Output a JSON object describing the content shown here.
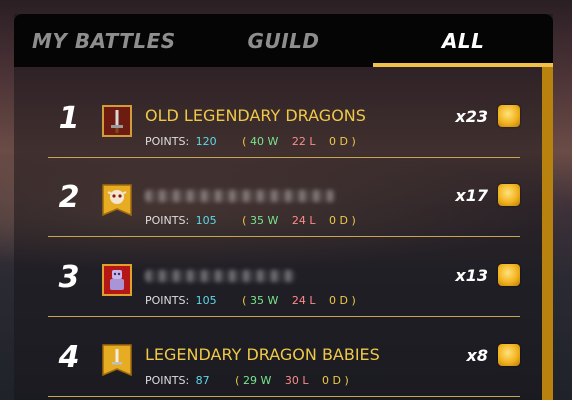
{
  "tabs": [
    {
      "label": "MY BATTLES",
      "active": false
    },
    {
      "label": "GUILD",
      "active": false
    },
    {
      "label": "ALL",
      "active": true
    }
  ],
  "colors": {
    "accent": "#f0c048",
    "scrollbar": "#b9820f"
  },
  "rows": [
    {
      "rank": "1",
      "name": "OLD LEGENDARY DRAGONS",
      "name_obscured": false,
      "banner": "red-sword-banner-icon",
      "points_label": "POINTS:",
      "points": "120",
      "wins": "40 W",
      "losses": "22 L",
      "draws": "0 D",
      "multiplier": "x23",
      "reward_icon": "gold-token-icon"
    },
    {
      "rank": "2",
      "name": "",
      "name_obscured": true,
      "banner": "gold-skull-banner-icon",
      "points_label": "POINTS:",
      "points": "105",
      "wins": "35 W",
      "losses": "24 L",
      "draws": "0 D",
      "multiplier": "x17",
      "reward_icon": "gold-token-icon"
    },
    {
      "rank": "3",
      "name": "",
      "name_obscured": true,
      "banner": "red-robot-banner-icon",
      "points_label": "POINTS:",
      "points": "105",
      "wins": "35 W",
      "losses": "24 L",
      "draws": "0 D",
      "multiplier": "x13",
      "reward_icon": "gold-token-icon"
    },
    {
      "rank": "4",
      "name": "LEGENDARY DRAGON BABIES",
      "name_obscured": false,
      "banner": "gold-sword-banner-icon",
      "points_label": "POINTS:",
      "points": "87",
      "wins": "29 W",
      "losses": "30 L",
      "draws": "0 D",
      "multiplier": "x8",
      "reward_icon": "gold-token-icon"
    }
  ],
  "paren_open": "(",
  "paren_close": ")"
}
